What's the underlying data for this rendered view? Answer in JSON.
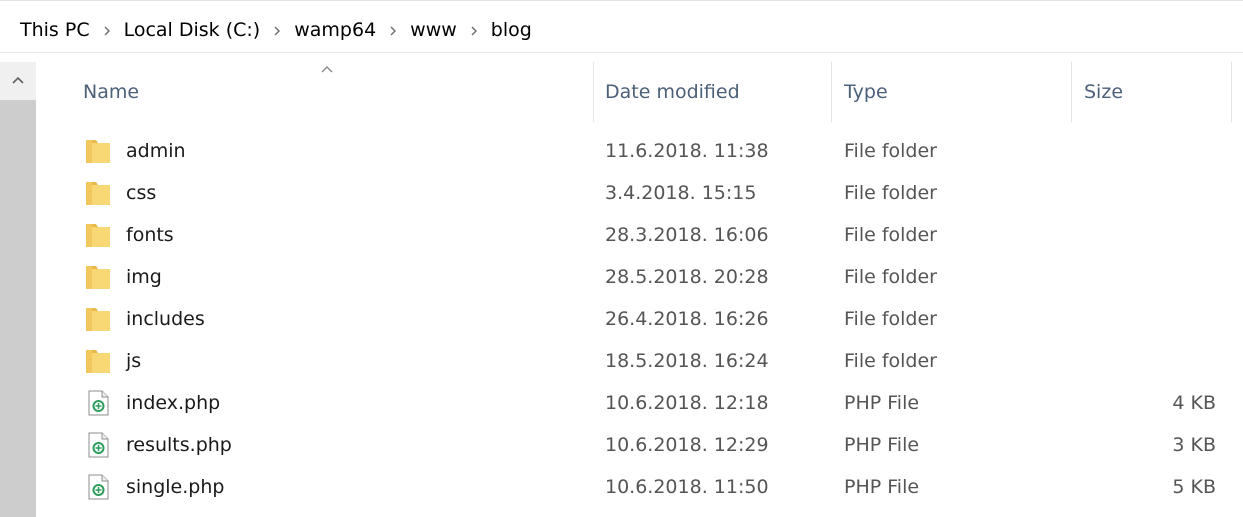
{
  "breadcrumb": [
    "This PC",
    "Local Disk (C:)",
    "wamp64",
    "www",
    "blog"
  ],
  "columns": {
    "name": "Name",
    "date_modified": "Date modified",
    "type": "Type",
    "size": "Size"
  },
  "files": [
    {
      "name": "admin",
      "date": "11.6.2018. 11:38",
      "type": "File folder",
      "size": "",
      "icon": "folder-icon"
    },
    {
      "name": "css",
      "date": "3.4.2018. 15:15",
      "type": "File folder",
      "size": "",
      "icon": "folder-icon"
    },
    {
      "name": "fonts",
      "date": "28.3.2018. 16:06",
      "type": "File folder",
      "size": "",
      "icon": "folder-icon"
    },
    {
      "name": "img",
      "date": "28.5.2018. 20:28",
      "type": "File folder",
      "size": "",
      "icon": "folder-icon"
    },
    {
      "name": "includes",
      "date": "26.4.2018. 16:26",
      "type": "File folder",
      "size": "",
      "icon": "folder-icon"
    },
    {
      "name": "js",
      "date": "18.5.2018. 16:24",
      "type": "File folder",
      "size": "",
      "icon": "folder-icon"
    },
    {
      "name": "index.php",
      "date": "10.6.2018. 12:18",
      "type": "PHP File",
      "size": "4 KB",
      "icon": "php-file-icon"
    },
    {
      "name": "results.php",
      "date": "10.6.2018. 12:29",
      "type": "PHP File",
      "size": "3 KB",
      "icon": "php-file-icon"
    },
    {
      "name": "single.php",
      "date": "10.6.2018. 11:50",
      "type": "PHP File",
      "size": "5 KB",
      "icon": "php-file-icon"
    }
  ],
  "colors": {
    "header_text": "#4c607a",
    "folder": "#f8d775",
    "php_icon": "#2e9d5c"
  }
}
